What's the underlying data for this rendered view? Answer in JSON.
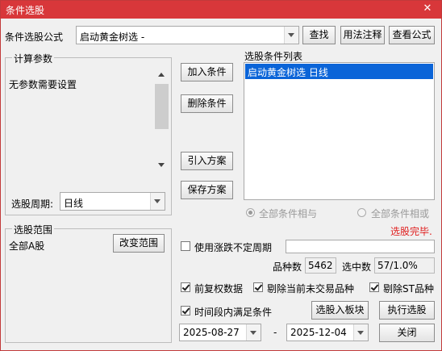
{
  "window": {
    "title": "条件选股",
    "close_glyph": "✕"
  },
  "formula": {
    "label": "条件选股公式",
    "selected": "启动黄金树选  -"
  },
  "top_buttons": {
    "find": "查找",
    "usage": "用法注释",
    "view": "查看公式"
  },
  "params_group": {
    "title": "计算参数",
    "message": "无参数需要设置",
    "period_label": "选股周期:",
    "period_value": "日线"
  },
  "condition_buttons": {
    "add": "加入条件",
    "remove": "删除条件",
    "import": "引入方案",
    "save": "保存方案"
  },
  "condition_list": {
    "title": "选股条件列表",
    "items": [
      "启动黄金树选  日线"
    ]
  },
  "logic": {
    "and_label": "全部条件相与",
    "or_label": "全部条件相或",
    "selected": "and"
  },
  "status": {
    "text": "选股完毕.",
    "color": "#e02020"
  },
  "range_group": {
    "title": "选股范围",
    "value": "全部A股",
    "change_button": "改变范围"
  },
  "uneven_period": {
    "label": "使用涨跌不定周期",
    "checked": false,
    "value": ""
  },
  "stats": {
    "count_label": "品种数",
    "count_value": "5462",
    "hit_label": "选中数",
    "hit_value": "57/1.0%"
  },
  "options": {
    "adjusted": {
      "label": "前复权数据",
      "checked": true
    },
    "exclude_untraded": {
      "label": "剔除当前未交易品种",
      "checked": true
    },
    "exclude_st": {
      "label": "剔除ST品种",
      "checked": true
    },
    "time_range": {
      "label": "时间段内满足条件",
      "checked": true
    }
  },
  "action_buttons": {
    "to_board": "选股入板块",
    "run": "执行选股",
    "close": "关闭"
  },
  "dates": {
    "start": "2025-08-27",
    "separator": "-",
    "end": "2025-12-04"
  },
  "colors": {
    "titlebar": "#d8373a",
    "selection": "#0a64d8"
  }
}
